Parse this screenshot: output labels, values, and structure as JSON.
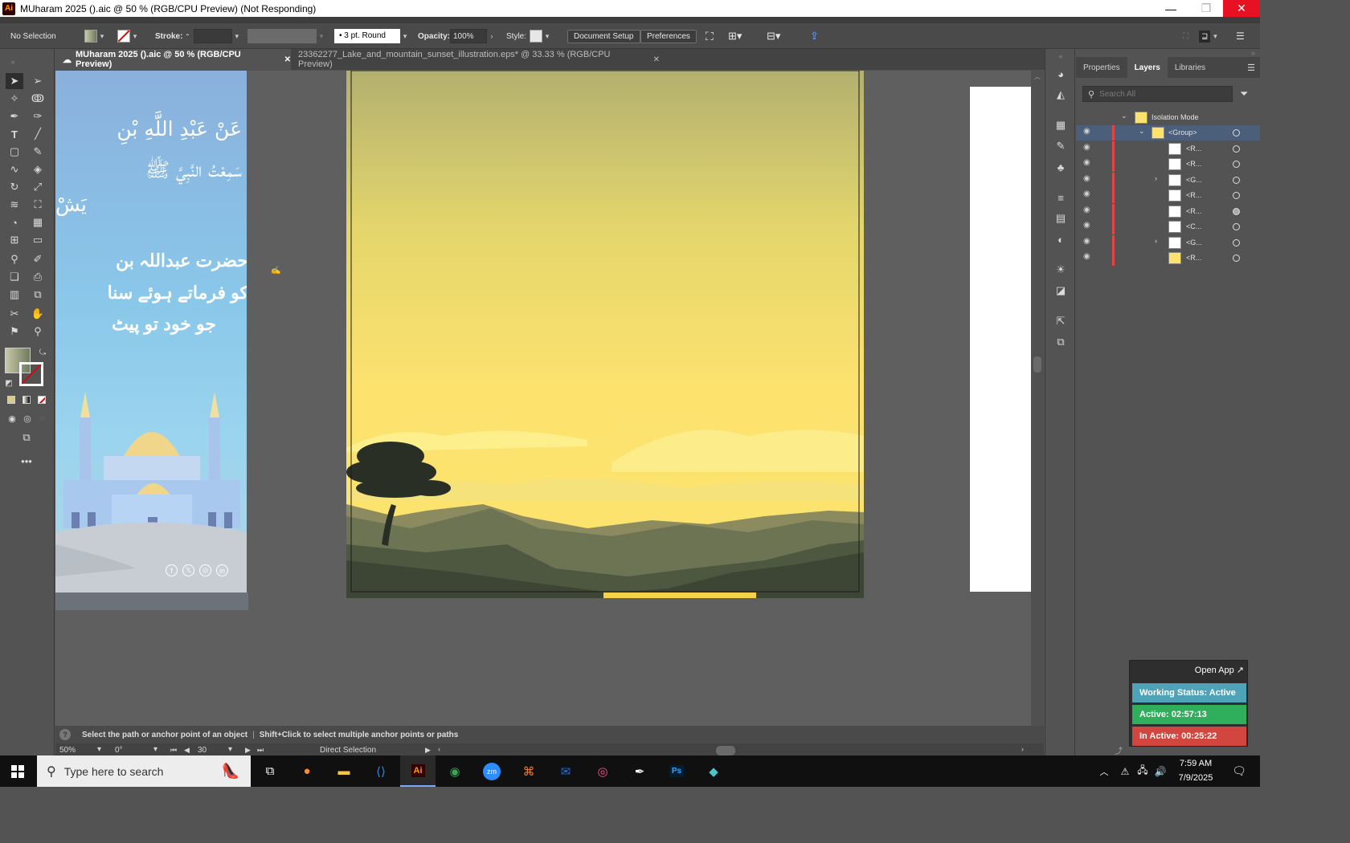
{
  "window": {
    "title": "MUharam 2025 ().aic @ 50 % (RGB/CPU Preview)  (Not Responding)",
    "app_logo": "Ai",
    "minimize": "—",
    "restore": "❐",
    "close": "✕"
  },
  "controlbar": {
    "selection": "No Selection",
    "stroke_label": "Stroke:",
    "brush": "3 pt. Round",
    "opacity_label": "Opacity:",
    "opacity_value": "100%",
    "style_label": "Style:",
    "document_setup": "Document Setup",
    "preferences": "Preferences"
  },
  "tabs": [
    {
      "label": "MUharam 2025 ().aic @ 50 % (RGB/CPU Preview)",
      "close": "✕"
    },
    {
      "label": "23362277_Lake_and_mountain_sunset_illustration.eps* @ 33.33 % (RGB/CPU Preview)",
      "close": "✕"
    }
  ],
  "artboard_left": {
    "arabic_line1": "عَنْ عَبْدِ اللَّهِ بْنِ",
    "arabic_line2": "سَمِعْتُ النَّبِيَّ ﷺ",
    "arabic_line3": "يَشْ",
    "urdu_line1": "حضرت عبداللہ بن",
    "urdu_line2": "کو فرماتے ہوئے سنا",
    "urdu_line3": "جو خود تو پیٹ",
    "social": [
      "f",
      "𝕏",
      "◎",
      "in"
    ]
  },
  "panel": {
    "tabs": [
      "Properties",
      "Layers",
      "Libraries"
    ],
    "search_placeholder": "Search All",
    "isolation_label": "Isolation Mode",
    "layers": [
      {
        "name": "<Group>",
        "selected": true,
        "expanded": true
      },
      {
        "name": "<R..."
      },
      {
        "name": "<R..."
      },
      {
        "name": "<G...",
        "expandable": true
      },
      {
        "name": "<R..."
      },
      {
        "name": "<R..."
      },
      {
        "name": "<C..."
      },
      {
        "name": "<G...",
        "expandable": true
      },
      {
        "name": "<R..."
      }
    ]
  },
  "status": {
    "hint": "Select the path or anchor point of an object",
    "hint2": "Shift+Click to select multiple anchor points or paths",
    "zoom": "50%",
    "rotation": "0°",
    "artboard": "30",
    "tool": "Direct Selection"
  },
  "widget": {
    "open_app": "Open App ↗",
    "working_status": "Working Status: Active",
    "active": "Active: 02:57:13",
    "inactive": "In Active: 00:25:22",
    "colors": {
      "status": "#4fa3b8",
      "active": "#2fae5b",
      "inactive": "#d1473f"
    }
  },
  "taskbar": {
    "search_placeholder": "Type here to search",
    "time": "7:59 AM",
    "date": "7/9/2025"
  }
}
